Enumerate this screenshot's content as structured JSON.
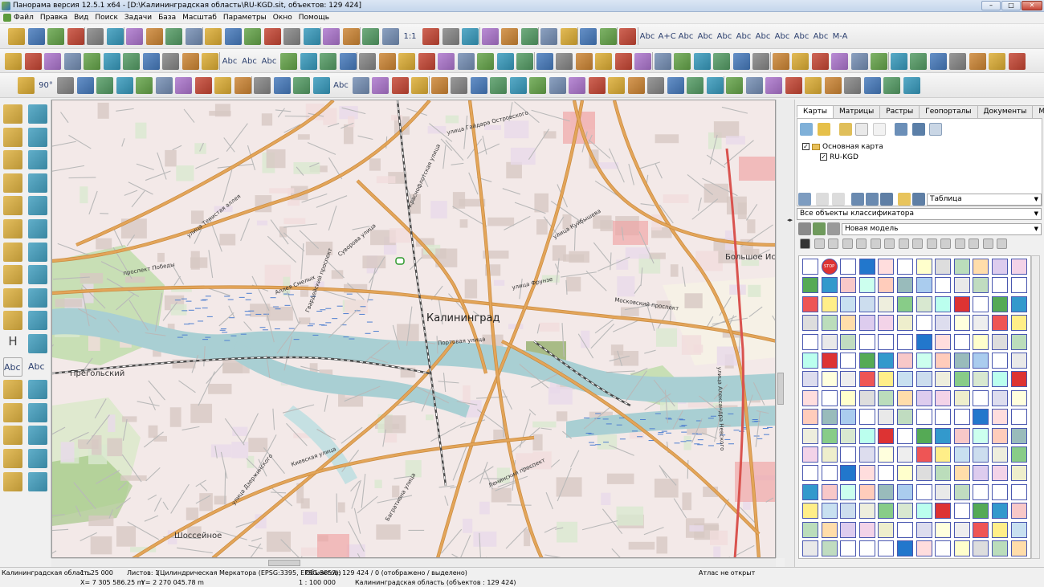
{
  "window": {
    "title": "Панорама версия 12.5.1 x64 - [D:\\Калининградская область\\RU-KGD.sit, объектов: 129 424]",
    "btn_min": "–",
    "btn_max": "□",
    "btn_close": "✕"
  },
  "menu": [
    "Файл",
    "Правка",
    "Вид",
    "Поиск",
    "Задачи",
    "База",
    "Масштаб",
    "Параметры",
    "Окно",
    "Помощь"
  ],
  "toolbar": {
    "scale_1to1": "1:1",
    "text_samples": [
      "Abc",
      "A+C",
      "Abc",
      "Abc",
      "Abc",
      "Abc",
      "Abc",
      "Abc",
      "Abc",
      "Abc",
      "M-A"
    ],
    "row2_text": [
      "Abc",
      "Abc",
      "Abc"
    ],
    "row3_text": [
      "90°",
      "Abc"
    ]
  },
  "left_toolbar": {
    "text_h": "H",
    "text_abc1": "Abc",
    "text_abc2": "Abc"
  },
  "map": {
    "city": "Калининград",
    "places": [
      "Прегольский",
      "Шоссейное",
      "Большое Исаково"
    ],
    "streets": [
      "улица Гайдара Островского",
      "улица Тенистая аллея",
      "проспект Победы",
      "улица Куйбышева",
      "улица Фрунзе",
      "Московский проспект",
      "Портовая улица",
      "Киевская улица",
      "улица Дзержинского",
      "Аллея Смелых",
      "Суворова улица",
      "Багратиона улица",
      "Гвардейский проспект",
      "Ленинский проспект",
      "улица Александра Невского",
      "Краснофлотская улица"
    ]
  },
  "panel": {
    "tabs": [
      "Карты",
      "Матрицы",
      "Растры",
      "Геопорталы",
      "Документы",
      "Модели"
    ],
    "active_tab": "Карты",
    "tree": {
      "root": "Основная карта",
      "child": "RU-KGD"
    },
    "view_select": "Таблица",
    "filter_select": "Все объекты классификатора",
    "model_select": "Новая модель",
    "palette_labels": {
      "stop": "STOP"
    }
  },
  "status": {
    "region": "Калининградская область",
    "scale": "1 : 25 000",
    "sheets": "Листов: 1",
    "projection": "(Цилиндрическая Меркатора (EPSG:3395, EPSG:3857))",
    "objects": "Объектов: 129 424 / 0 (отображено / выделено)",
    "atlas": "Атлас не открыт",
    "x_coord": "X= 7 305 586.25 m",
    "y_coord": "Y= 2 270 045.78 m",
    "scale2": "1 : 100 000",
    "region2": "Калининградская область  (объектов : 129 424)"
  },
  "colors": {
    "map_bg": "#f3e9e8",
    "water": "#a9cfd3",
    "park": "#c8dfb5",
    "forest": "#8fbf6f",
    "major_road": "#e3a559",
    "street": "#b9b9b9",
    "building": "#d7c8c3",
    "rail": "#4a4a4a",
    "accent_blue": "#2f5fb3"
  }
}
